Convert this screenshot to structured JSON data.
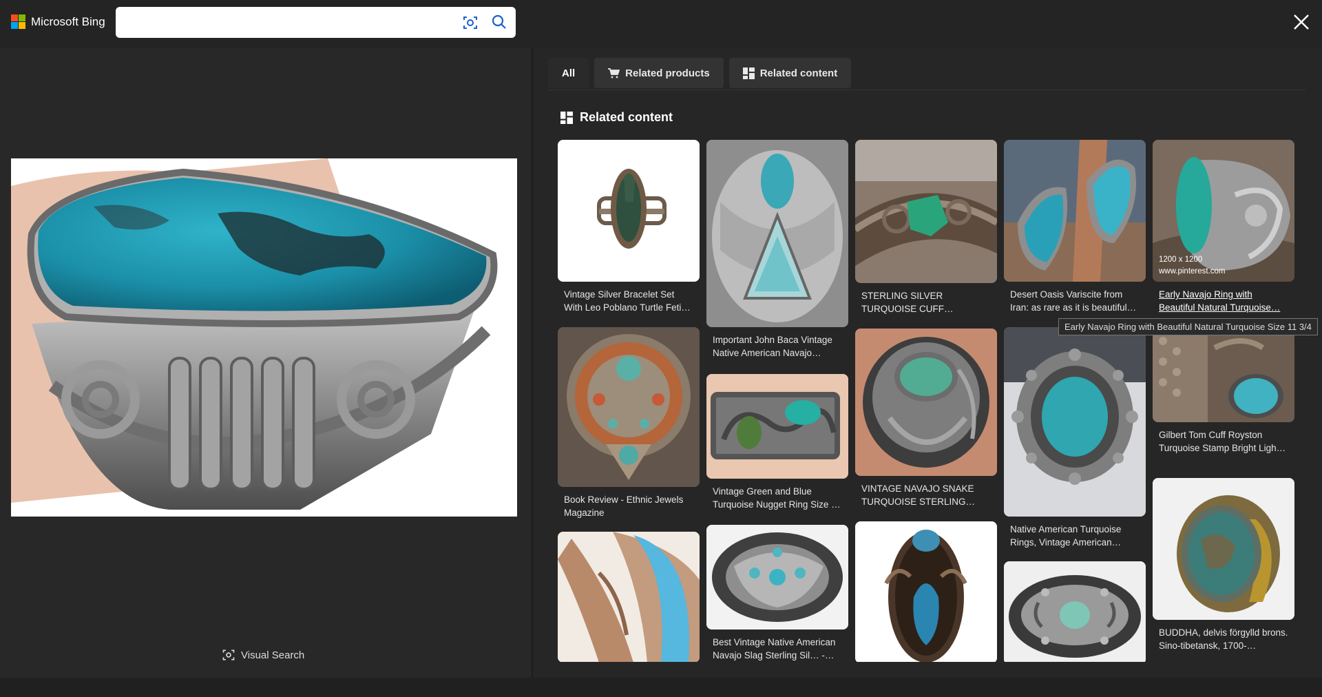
{
  "brand": {
    "name": "Microsoft Bing",
    "colors": [
      "#f25022",
      "#7fba00",
      "#00a4ef",
      "#ffb900"
    ]
  },
  "search": {
    "value": "",
    "placeholder": ""
  },
  "tabs": [
    {
      "label": "All",
      "icon": ""
    },
    {
      "label": "Related products",
      "icon": "cart-icon"
    },
    {
      "label": "Related content",
      "icon": "grid-icon"
    }
  ],
  "section": {
    "title": "Related content",
    "icon": "grid-icon"
  },
  "visual_search": {
    "label": "Visual Search",
    "icon": "visual-search-icon"
  },
  "results": [
    {
      "caption": "Vintage Silver Bracelet Set With Leo Poblano Turtle Feti…"
    },
    {
      "caption": "Important John Baca Vintage Native American Navajo…"
    },
    {
      "caption": "STERLING SILVER TURQUOISE CUFF…"
    },
    {
      "caption": "Desert Oasis Variscite from Iran: as rare as it is beautiful…"
    },
    {
      "caption": "Early Navajo Ring with Beautiful Natural Turquoise…",
      "dimensions": "1200 x 1200",
      "domain": "www.pinterest.com"
    },
    {
      "caption": "Book Review - Ethnic Jewels Magazine"
    },
    {
      "caption": "Vintage Green and Blue Turquoise Nugget Ring Size …"
    },
    {
      "caption": "VINTAGE NAVAJO SNAKE TURQUOISE STERLING…"
    },
    {
      "caption": "Native American Turquoise Rings, Vintage American…"
    },
    {
      "caption": "Gilbert Tom Cuff Royston Turquoise Stamp Bright Ligh…"
    },
    {
      "caption": ""
    },
    {
      "caption": "Best Vintage Native American Navajo Slag Sterling Sil… -…"
    },
    {
      "caption": ""
    },
    {
      "caption": ""
    },
    {
      "caption": "BUDDHA, delvis förgylld brons. Sino-tibetansk, 1700-…"
    }
  ],
  "tooltip": "Early Navajo Ring with Beautiful Natural Turquoise Size 11 3/4"
}
